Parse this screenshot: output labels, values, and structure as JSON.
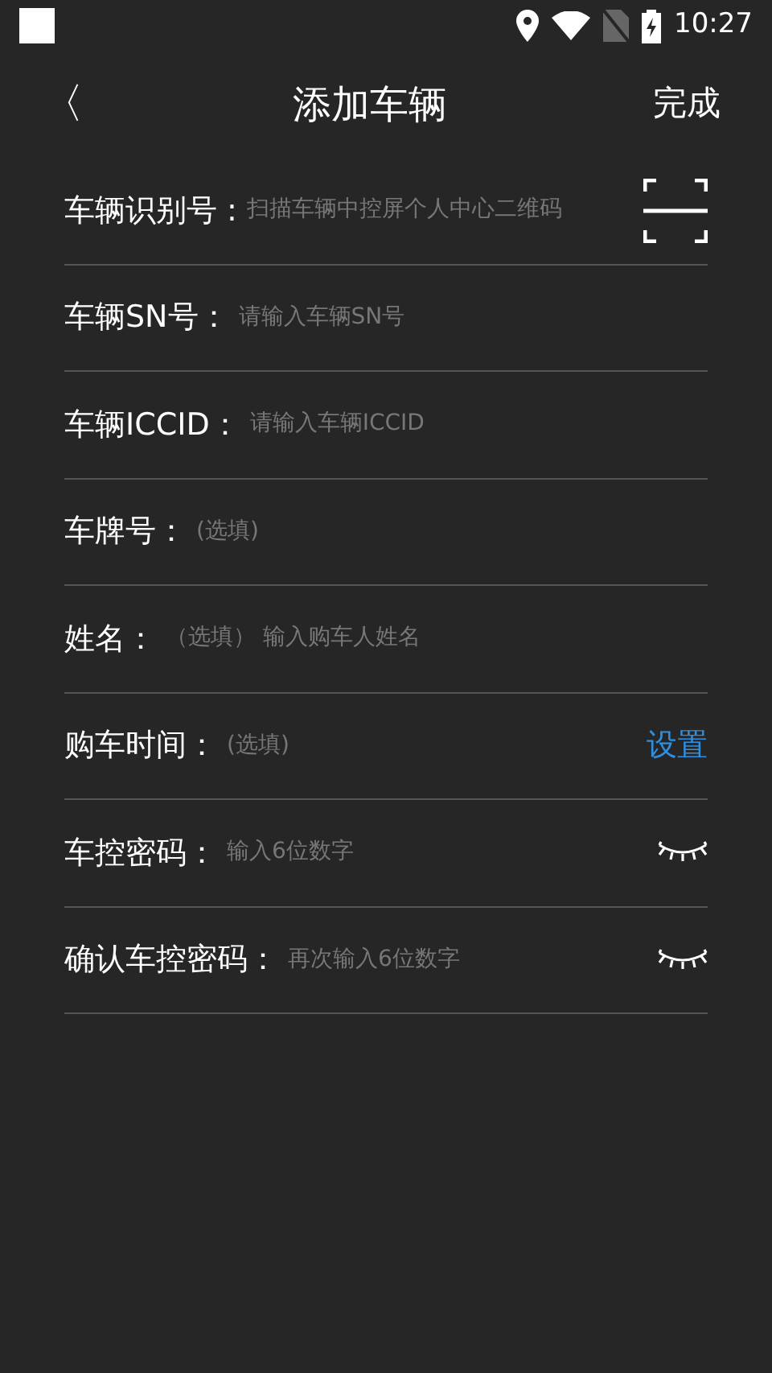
{
  "status_bar": {
    "time": "10:27"
  },
  "header": {
    "back": "〈",
    "title": "添加车辆",
    "action": "完成"
  },
  "fields": [
    {
      "kind": "scan",
      "label": "车辆识别号 :",
      "placeholder": "扫描车辆中控屏个人中心二维码"
    },
    {
      "kind": "text",
      "label": "车辆SN号：",
      "placeholder": "请输入车辆SN号"
    },
    {
      "kind": "text",
      "label": "车辆ICCID：",
      "placeholder": "请输入车辆ICCID"
    },
    {
      "kind": "text",
      "label": "车牌号：",
      "placeholder": "(选填)"
    },
    {
      "kind": "text",
      "label": "姓名：",
      "placeholder": "（选填） 输入购车人姓名"
    },
    {
      "kind": "action",
      "label": "购车时间：",
      "placeholder": "(选填)",
      "action": "设置"
    },
    {
      "kind": "password",
      "label": "车控密码：",
      "placeholder": "输入6位数字"
    },
    {
      "kind": "password",
      "label": "确认车控密码：",
      "placeholder": "再次输入6位数字"
    }
  ]
}
